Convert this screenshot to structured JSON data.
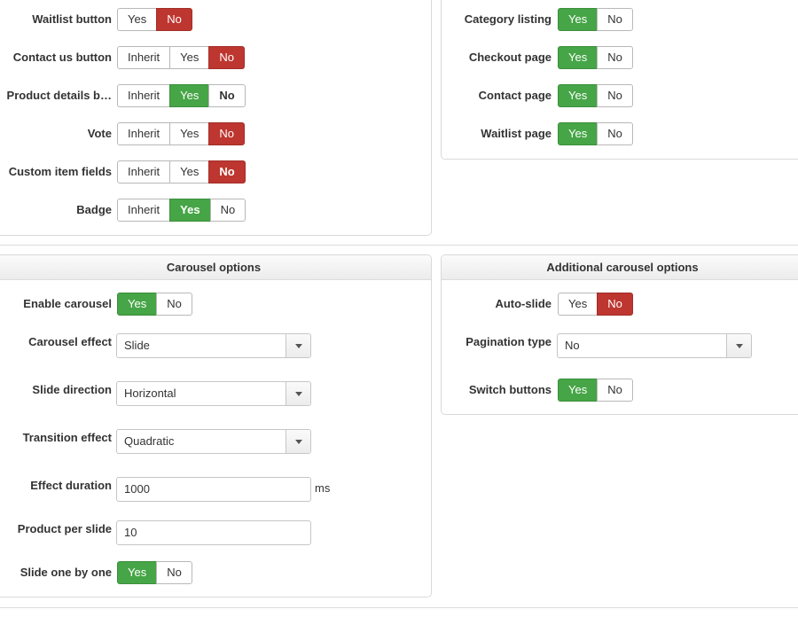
{
  "labels": {
    "waitlist_button": "Waitlist button",
    "contact_us_button": "Contact us button",
    "product_details_button": "Product details b…",
    "vote": "Vote",
    "custom_item_fields": "Custom item fields",
    "badge": "Badge",
    "category_listing": "Category listing",
    "checkout_page": "Checkout page",
    "contact_page": "Contact page",
    "waitlist_page": "Waitlist page",
    "enable_carousel": "Enable carousel",
    "carousel_effect": "Carousel effect",
    "slide_direction": "Slide direction",
    "transition_effect": "Transition effect",
    "effect_duration": "Effect duration",
    "product_per_slide": "Product per slide",
    "slide_one_by_one": "Slide one by one",
    "auto_slide": "Auto-slide",
    "pagination_type": "Pagination type",
    "switch_buttons": "Switch buttons"
  },
  "options": {
    "inherit": "Inherit",
    "yes": "Yes",
    "no": "No"
  },
  "panels": {
    "carousel_options": "Carousel options",
    "additional_carousel_options": "Additional carousel options"
  },
  "fields": {
    "carousel_effect": "Slide",
    "slide_direction": "Horizontal",
    "transition_effect": "Quadratic",
    "effect_duration": "1000",
    "effect_duration_unit": "ms",
    "product_per_slide": "10",
    "pagination_type": "No"
  },
  "colors": {
    "selected_yes": "#46a546",
    "selected_no": "#bd362f"
  }
}
